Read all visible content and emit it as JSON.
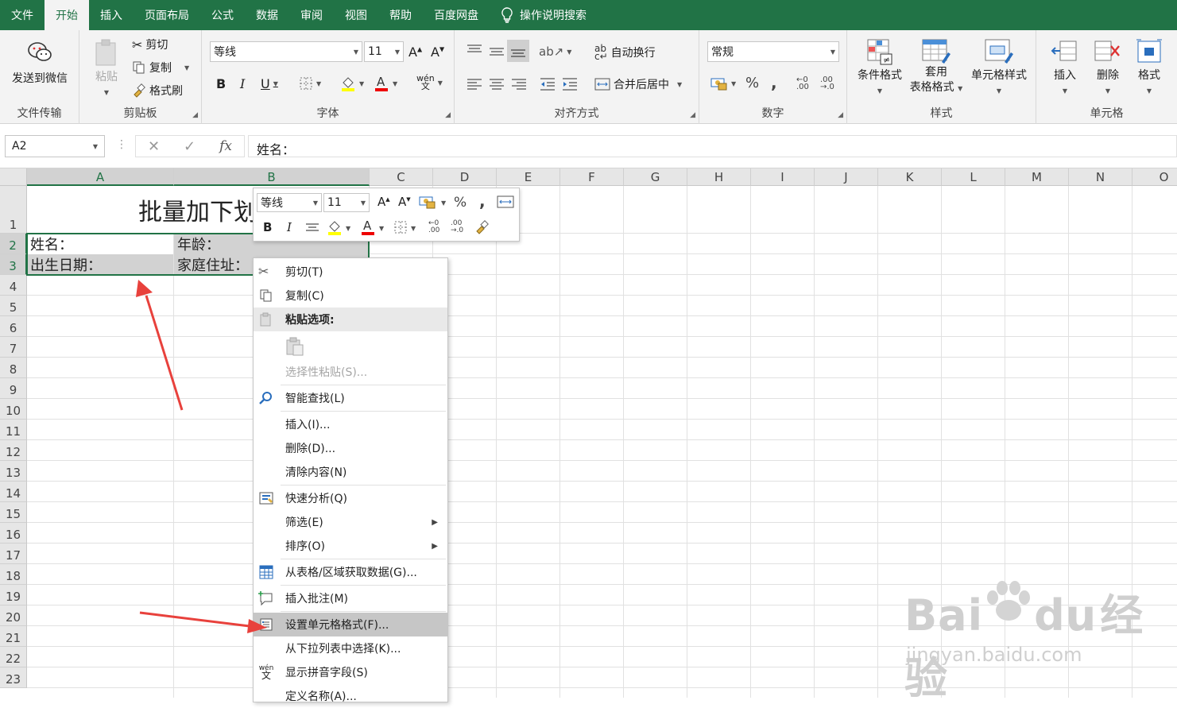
{
  "tabs": [
    "文件",
    "开始",
    "插入",
    "页面布局",
    "公式",
    "数据",
    "审阅",
    "视图",
    "帮助",
    "百度网盘"
  ],
  "tell_me": "操作说明搜索",
  "ribbon": {
    "wechat_label": "发送到微信",
    "wechat_group": "文件传输",
    "paste_label": "粘贴",
    "cut_label": "剪切",
    "copy_label": "复制",
    "format_painter_label": "格式刷",
    "clipboard_group": "剪贴板",
    "font_name": "等线",
    "font_size": "11",
    "font_group": "字体",
    "wrap_label": "自动换行",
    "merge_label": "合并后居中",
    "align_group": "对齐方式",
    "number_format": "常规",
    "number_group": "数字",
    "cond_format_label": "条件格式",
    "table_format_line1": "套用",
    "table_format_line2": "表格格式",
    "cell_style_label": "单元格样式",
    "styles_group": "样式",
    "insert_label": "插入",
    "delete_label": "删除",
    "format_label": "格式",
    "cells_group": "单元格"
  },
  "formula_bar": {
    "name_box": "A2",
    "formula": "姓名："
  },
  "columns": [
    "A",
    "B",
    "C",
    "D",
    "E",
    "F",
    "G",
    "H",
    "I",
    "J",
    "K",
    "L",
    "M",
    "N",
    "O"
  ],
  "rows": [
    "1",
    "2",
    "3",
    "4",
    "5",
    "6",
    "7",
    "8",
    "9",
    "10",
    "11",
    "12",
    "13",
    "14",
    "15",
    "16",
    "17",
    "18",
    "19",
    "20",
    "21",
    "22",
    "23"
  ],
  "cells": {
    "title": "批量加下划",
    "a2": "姓名：",
    "b2": "年龄：",
    "a3": "出生日期：",
    "b3": "家庭住址："
  },
  "mini_toolbar": {
    "font": "等线",
    "size": "11"
  },
  "context_menu": [
    {
      "label": "剪切(T)",
      "icon": "scissors-icon"
    },
    {
      "label": "复制(C)",
      "icon": "copy-icon"
    },
    {
      "label": "粘贴选项:",
      "icon": "paste-icon"
    },
    {
      "label": "",
      "icon": "paste-option-icon"
    },
    {
      "label": "选择性粘贴(S)...",
      "icon": ""
    },
    {
      "label": "智能查找(L)",
      "icon": "smart-lookup-icon"
    },
    {
      "label": "插入(I)...",
      "icon": ""
    },
    {
      "label": "删除(D)...",
      "icon": ""
    },
    {
      "label": "清除内容(N)",
      "icon": ""
    },
    {
      "label": "快速分析(Q)",
      "icon": "quick-analysis-icon"
    },
    {
      "label": "筛选(E)",
      "icon": ""
    },
    {
      "label": "排序(O)",
      "icon": ""
    },
    {
      "label": "从表格/区域获取数据(G)...",
      "icon": "table-icon"
    },
    {
      "label": "插入批注(M)",
      "icon": "comment-icon"
    },
    {
      "label": "设置单元格格式(F)...",
      "icon": "format-cells-icon"
    },
    {
      "label": "从下拉列表中选择(K)...",
      "icon": ""
    },
    {
      "label": "显示拼音字段(S)",
      "icon": "phonetic-icon"
    },
    {
      "label": "定义名称(A)...",
      "icon": ""
    }
  ],
  "watermark": {
    "brand": "Bai",
    "brand2": "du",
    "brand3": "经验",
    "url": "jingyan.baidu.com"
  },
  "colors": {
    "excel_green": "#217346",
    "arrow_red": "#e8413c",
    "highlight": "#c6c6c6"
  }
}
